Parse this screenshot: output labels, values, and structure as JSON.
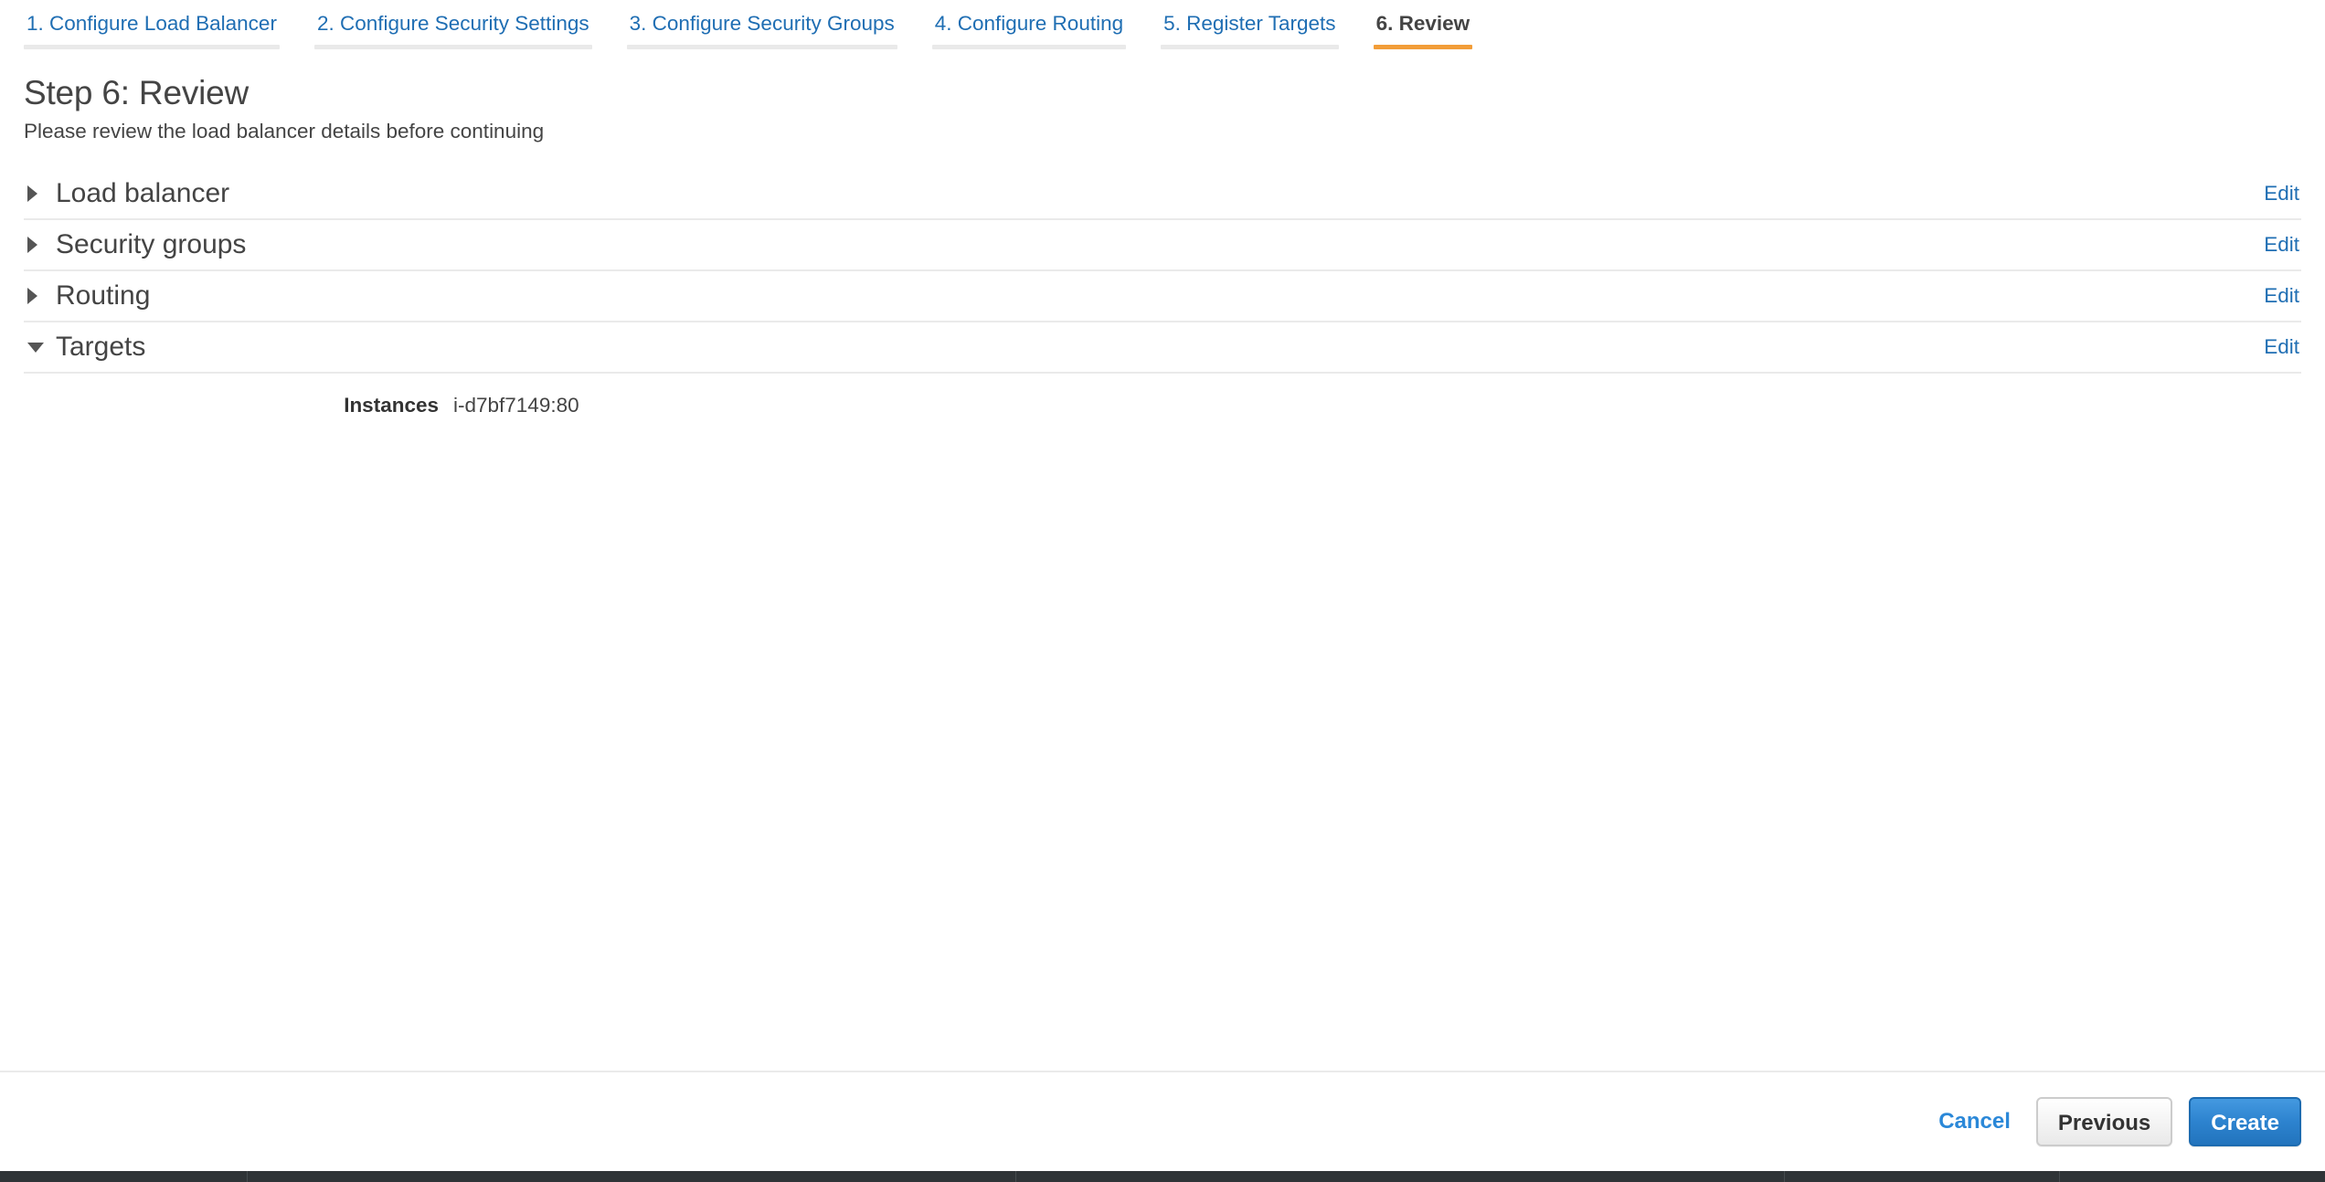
{
  "wizard": {
    "tabs": [
      {
        "label": "1. Configure Load Balancer",
        "active": false
      },
      {
        "label": "2. Configure Security Settings",
        "active": false
      },
      {
        "label": "3. Configure Security Groups",
        "active": false
      },
      {
        "label": "4. Configure Routing",
        "active": false
      },
      {
        "label": "5. Register Targets",
        "active": false
      },
      {
        "label": "6. Review",
        "active": true
      }
    ],
    "active_tab_index": 5,
    "accent_color": "#f29d38",
    "link_color": "#1f6eb3"
  },
  "page": {
    "title": "Step 6: Review",
    "subtitle": "Please review the load balancer details before continuing"
  },
  "sections": [
    {
      "title": "Load balancer",
      "edit_label": "Edit",
      "expanded": false,
      "details": []
    },
    {
      "title": "Security groups",
      "edit_label": "Edit",
      "expanded": false,
      "details": []
    },
    {
      "title": "Routing",
      "edit_label": "Edit",
      "expanded": false,
      "details": []
    },
    {
      "title": "Targets",
      "edit_label": "Edit",
      "expanded": true,
      "details": [
        {
          "label": "Instances",
          "value": "i-d7bf7149:80"
        }
      ]
    }
  ],
  "footer": {
    "cancel_label": "Cancel",
    "previous_label": "Previous",
    "create_label": "Create"
  },
  "icons": {
    "collapsed": "triangle-right-icon",
    "expanded": "triangle-down-icon"
  }
}
